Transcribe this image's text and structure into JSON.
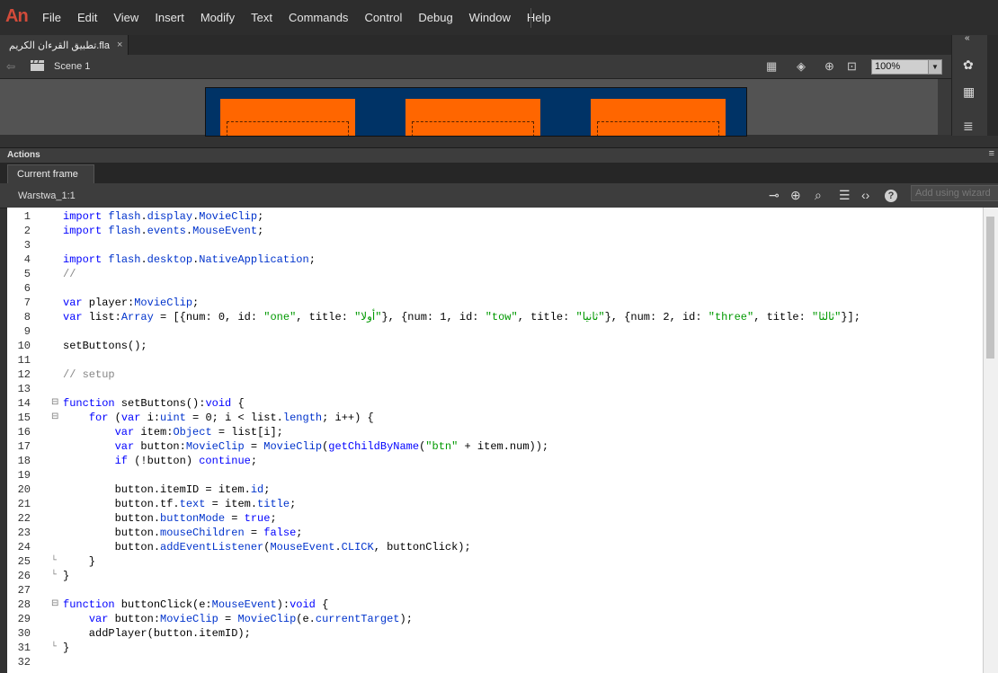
{
  "app": {
    "logo": "An"
  },
  "menu": [
    "File",
    "Edit",
    "View",
    "Insert",
    "Modify",
    "Text",
    "Commands",
    "Control",
    "Debug",
    "Window",
    "Help"
  ],
  "document": {
    "tab_label": "تطبيق القرءان الكريم.fla",
    "close_glyph": "×"
  },
  "scene": {
    "back_glyph": "⇦",
    "label": "Scene 1"
  },
  "zoom": {
    "value": "100%",
    "arrow": "▼"
  },
  "actions_panel": {
    "title": "Actions",
    "menu_glyph": "≡",
    "tab": "Current frame",
    "layer": "Warstwa_1:1",
    "wizard_placeholder": "Add using wizard"
  },
  "icons": {
    "pin": "⊸",
    "target": "⊕",
    "search": "⌕",
    "format": "☰",
    "code": "‹›",
    "help": "?",
    "clapper": "▦",
    "rotate": "◈",
    "center": "⊕",
    "fit": "⊡",
    "palette": "✿",
    "grid": "▦",
    "list": "≣",
    "collapse": "«"
  },
  "code_lines": [
    {
      "n": "1",
      "t": "import flash.display.MovieClip;"
    },
    {
      "n": "2",
      "t": "import flash.events.MouseEvent;"
    },
    {
      "n": "3",
      "t": ""
    },
    {
      "n": "4",
      "t": "import flash.desktop.NativeApplication;"
    },
    {
      "n": "5",
      "t": "//"
    },
    {
      "n": "6",
      "t": ""
    },
    {
      "n": "7",
      "t": "var player:MovieClip;"
    },
    {
      "n": "8",
      "t": "var list:Array = [{num: 0, id: \"one\", title: \"أولا\"}, {num: 1, id: \"tow\", title: \"ثانيا\"}, {num: 2, id: \"three\", title: \"ثالثا\"}];"
    },
    {
      "n": "9",
      "t": ""
    },
    {
      "n": "10",
      "t": "setButtons();"
    },
    {
      "n": "11",
      "t": ""
    },
    {
      "n": "12",
      "t": "// setup"
    },
    {
      "n": "13",
      "t": ""
    },
    {
      "n": "14",
      "t": "function setButtons():void {",
      "fold": "⊟"
    },
    {
      "n": "15",
      "t": "    for (var i:uint = 0; i < list.length; i++) {",
      "fold": "⊟"
    },
    {
      "n": "16",
      "t": "        var item:Object = list[i];"
    },
    {
      "n": "17",
      "t": "        var button:MovieClip = MovieClip(getChildByName(\"btn\" + item.num));"
    },
    {
      "n": "18",
      "t": "        if (!button) continue;"
    },
    {
      "n": "19",
      "t": ""
    },
    {
      "n": "20",
      "t": "        button.itemID = item.id;"
    },
    {
      "n": "21",
      "t": "        button.tf.text = item.title;"
    },
    {
      "n": "22",
      "t": "        button.buttonMode = true;"
    },
    {
      "n": "23",
      "t": "        button.mouseChildren = false;"
    },
    {
      "n": "24",
      "t": "        button.addEventListener(MouseEvent.CLICK, buttonClick);"
    },
    {
      "n": "25",
      "t": "    }",
      "fold": "└"
    },
    {
      "n": "26",
      "t": "}",
      "fold": "└"
    },
    {
      "n": "27",
      "t": ""
    },
    {
      "n": "28",
      "t": "function buttonClick(e:MouseEvent):void {",
      "fold": "⊟"
    },
    {
      "n": "29",
      "t": "    var button:MovieClip = MovieClip(e.currentTarget);"
    },
    {
      "n": "30",
      "t": "    addPlayer(button.itemID);"
    },
    {
      "n": "31",
      "t": "}",
      "fold": "└"
    },
    {
      "n": "32",
      "t": ""
    }
  ]
}
